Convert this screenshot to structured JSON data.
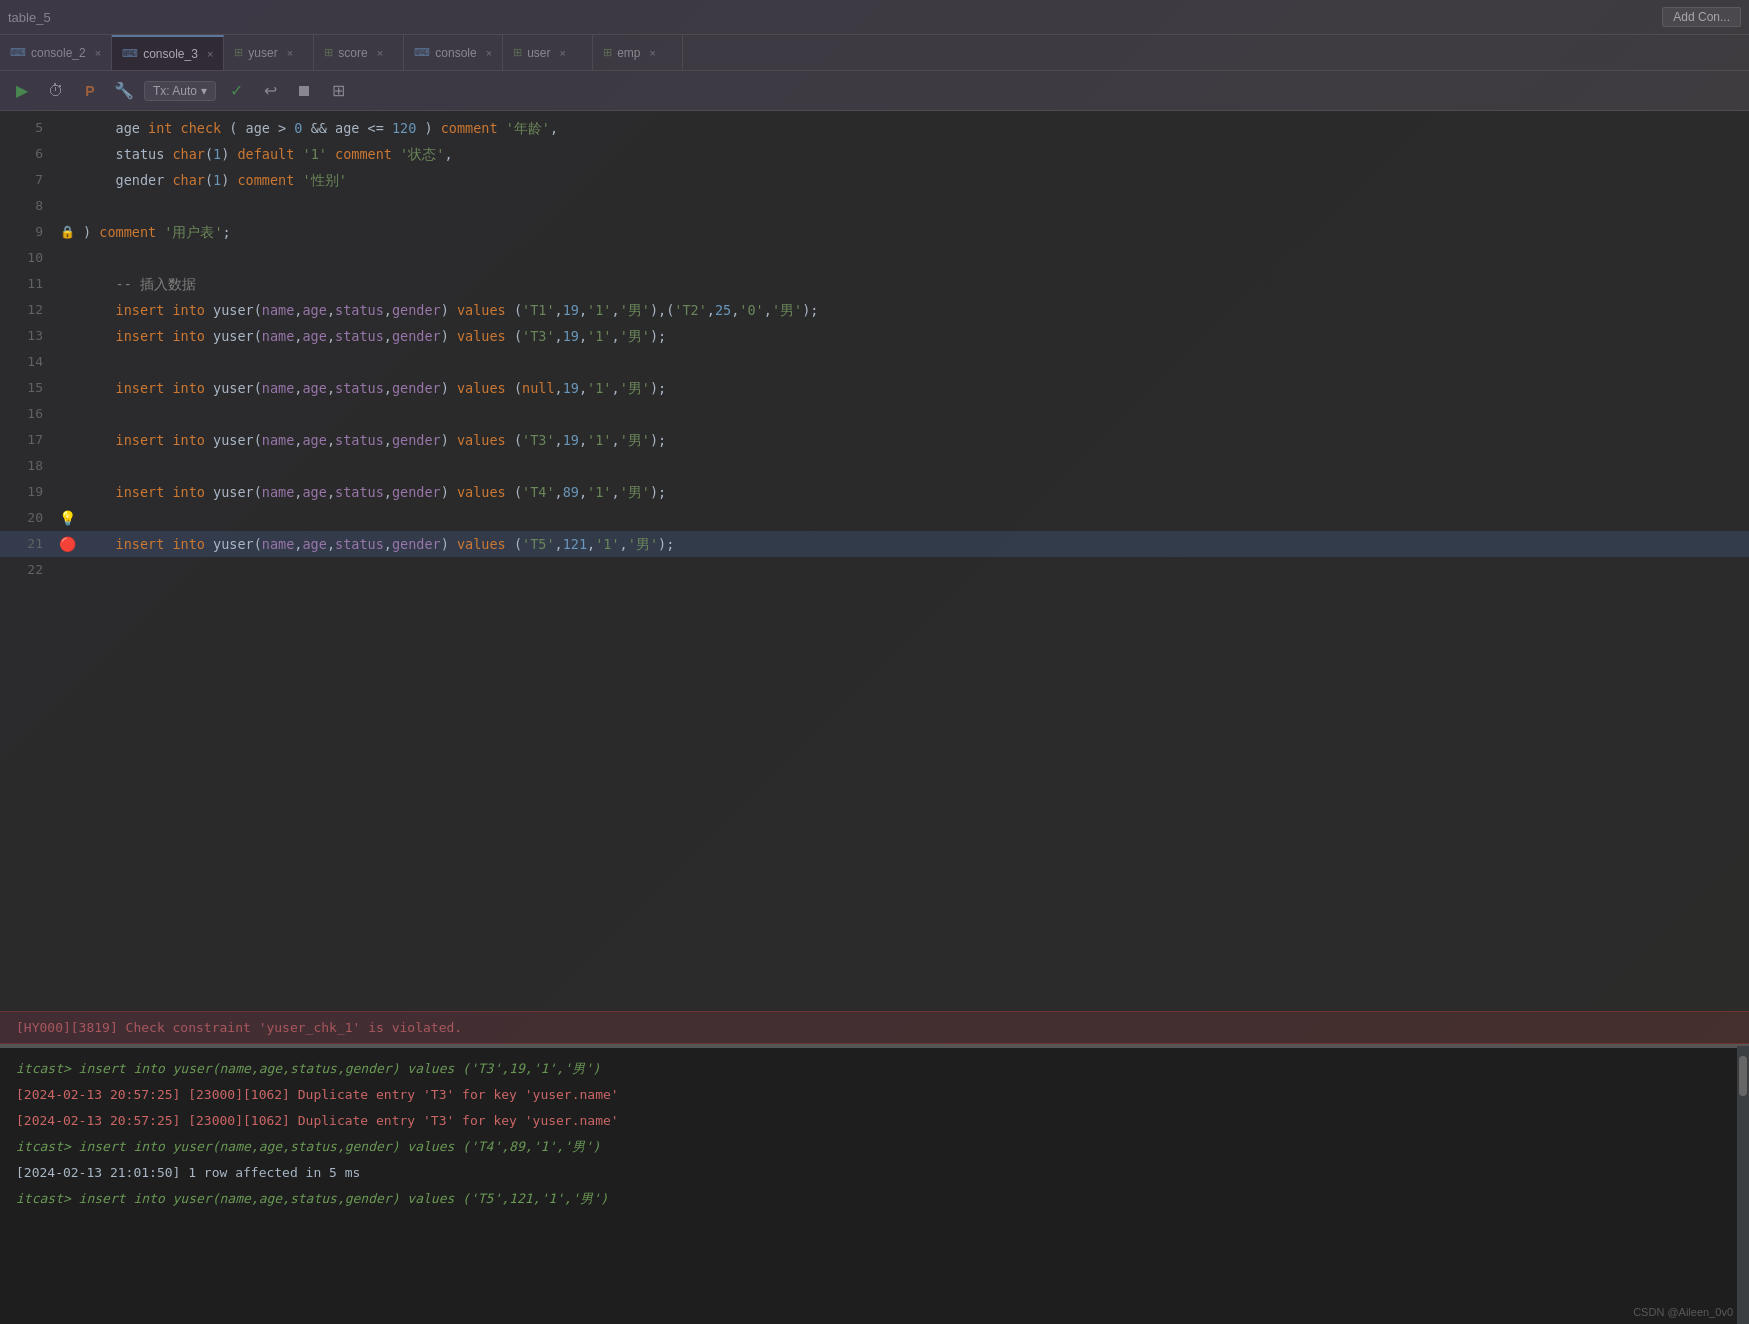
{
  "topBar": {
    "title": "table_5",
    "addBtn": "Add Con..."
  },
  "tabs": [
    {
      "id": "console2",
      "label": "console_2",
      "type": "console",
      "active": false,
      "closable": true
    },
    {
      "id": "console3",
      "label": "console_3",
      "type": "console",
      "active": true,
      "closable": true
    },
    {
      "id": "yuser",
      "label": "yuser",
      "type": "table",
      "active": false,
      "closable": true
    },
    {
      "id": "score",
      "label": "score",
      "type": "table",
      "active": false,
      "closable": true
    },
    {
      "id": "console",
      "label": "console",
      "type": "console",
      "active": false,
      "closable": true
    },
    {
      "id": "user",
      "label": "user",
      "type": "table",
      "active": false,
      "closable": true
    },
    {
      "id": "emp",
      "label": "emp",
      "type": "table",
      "active": false,
      "closable": true
    }
  ],
  "toolbar": {
    "runLabel": "▶",
    "historyLabel": "⏱",
    "pinLabel": "P",
    "wrenchLabel": "🔧",
    "txLabel": "Tx: Auto",
    "checkLabel": "✓",
    "undoLabel": "↩",
    "stopLabel": "⏹",
    "gridLabel": "⊞"
  },
  "codeLines": [
    {
      "num": 5,
      "gutter": "",
      "code": "    age int check ( age > 0 && age <= 120 ) comment '年龄',"
    },
    {
      "num": 6,
      "gutter": "",
      "code": "    status char(1) default '1' comment '状态',"
    },
    {
      "num": 7,
      "gutter": "",
      "code": "    gender char(1) comment '性别'"
    },
    {
      "num": 8,
      "gutter": "",
      "code": ""
    },
    {
      "num": 9,
      "gutter": "lock",
      "code": ") comment '用户表';"
    },
    {
      "num": 10,
      "gutter": "",
      "code": ""
    },
    {
      "num": 11,
      "gutter": "",
      "code": "-- 插入数据"
    },
    {
      "num": 12,
      "gutter": "",
      "code": "    insert into yuser(name,age,status,gender) values ('T1',19,'1','男'),('T2',25,'0','男');"
    },
    {
      "num": 13,
      "gutter": "",
      "code": "    insert into yuser(name,age,status,gender) values ('T3',19,'1','男');"
    },
    {
      "num": 14,
      "gutter": "",
      "code": ""
    },
    {
      "num": 15,
      "gutter": "",
      "code": "    insert into yuser(name,age,status,gender) values (null,19,'1','男');"
    },
    {
      "num": 16,
      "gutter": "",
      "code": ""
    },
    {
      "num": 17,
      "gutter": "",
      "code": "    insert into yuser(name,age,status,gender) values ('T3',19,'1','男');"
    },
    {
      "num": 18,
      "gutter": "",
      "code": ""
    },
    {
      "num": 19,
      "gutter": "",
      "code": "    insert into yuser(name,age,status,gender) values ('T4',89,'1','男');"
    },
    {
      "num": 20,
      "gutter": "bulb",
      "code": ""
    },
    {
      "num": 21,
      "gutter": "error",
      "code": "    insert into yuser(name,age,status,gender) values ('T5',121,'1','男');",
      "highlighted": true
    }
  ],
  "errorBar": {
    "message": "[HY000][3819] Check constraint 'yuser_chk_1' is violated."
  },
  "outputLines": [
    {
      "type": "prompt",
      "text": "itcast> insert into yuser(name,age,status,gender) values ('T3',19,'1','男')"
    },
    {
      "type": "error",
      "text": "[2024-02-13 20:57:25] [23000][1062] Duplicate entry 'T3' for key 'yuser.name'"
    },
    {
      "type": "error",
      "text": "[2024-02-13 20:57:25] [23000][1062] Duplicate entry 'T3' for key 'yuser.name'"
    },
    {
      "type": "prompt",
      "text": "itcast> insert into yuser(name,age,status,gender) values ('T4',89,'1','男')"
    },
    {
      "type": "success",
      "text": "[2024-02-13 21:01:50] 1 row affected in 5 ms"
    },
    {
      "type": "prompt",
      "text": "itcast> insert into yuser(name,age,status,gender) values ('T5',121,'1','男')"
    }
  ],
  "watermark": "CSDN @Aileen_0v0"
}
